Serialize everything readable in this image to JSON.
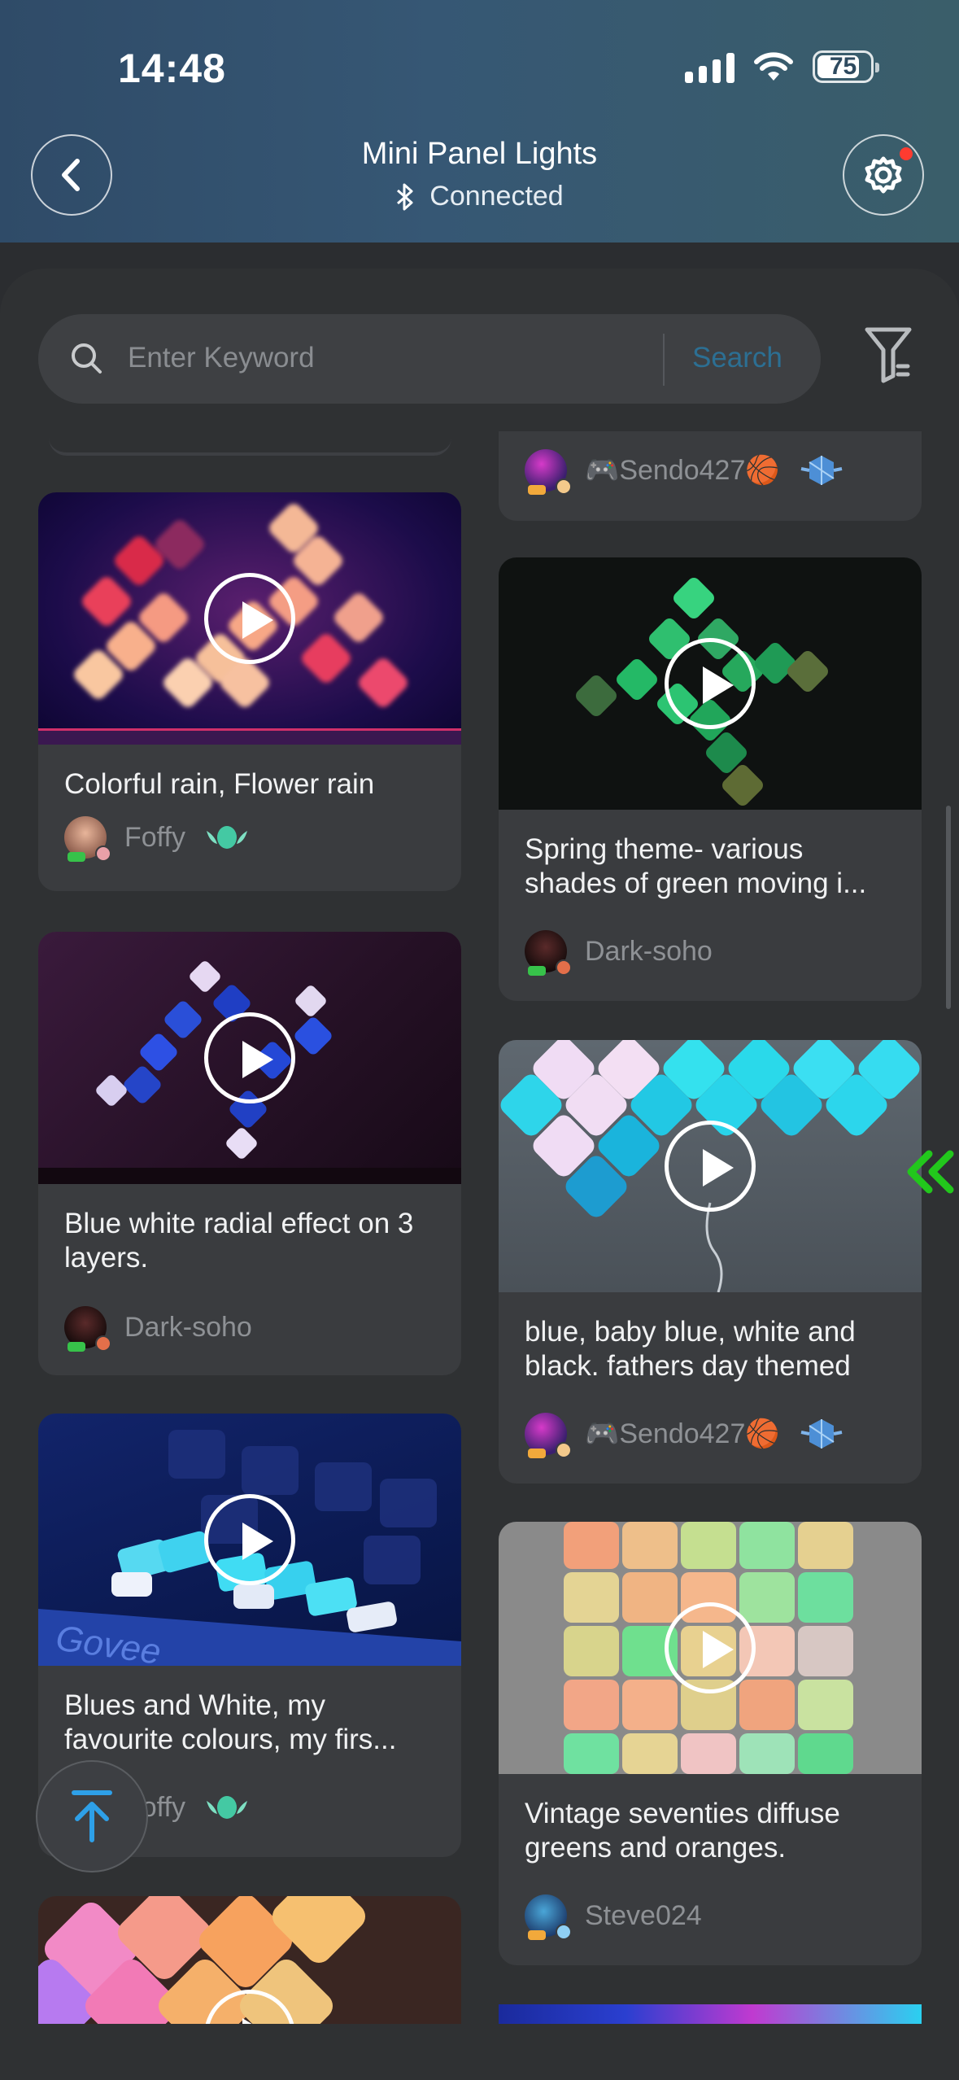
{
  "status_bar": {
    "time": "14:48",
    "battery": "75"
  },
  "header": {
    "title": "Mini Panel Lights",
    "subtitle": "Connected"
  },
  "search": {
    "placeholder": "Enter Keyword",
    "button_label": "Search"
  },
  "cards": [
    {
      "title": "Colorful rain, Flower rain",
      "author": "Foffy"
    },
    {
      "title": "Blue white radial effect on 3 layers.",
      "author": "Dark-soho"
    },
    {
      "title": "Blues and White, my favourite colours, my firs...",
      "author": "Foffy"
    },
    {
      "title": "",
      "author": "🎮Sendo427🏀"
    },
    {
      "title": "Spring theme- various shades of green moving i...",
      "author": "Dark-soho"
    },
    {
      "title": "blue, baby blue, white and black. fathers day themed",
      "author": "🎮Sendo427🏀"
    },
    {
      "title": "Vintage seventies diffuse greens and oranges.",
      "author": "Steve024"
    }
  ],
  "colors": {
    "accent_search": "#2c6f93",
    "play_icon": "#ffffff",
    "notification_dot": "#ff3b30",
    "side_arrows": "#22c71c"
  },
  "icons": [
    "back-chevron-icon",
    "settings-gear-icon",
    "bluetooth-icon",
    "search-icon",
    "filter-icon",
    "play-icon",
    "scroll-to-top-icon"
  ]
}
